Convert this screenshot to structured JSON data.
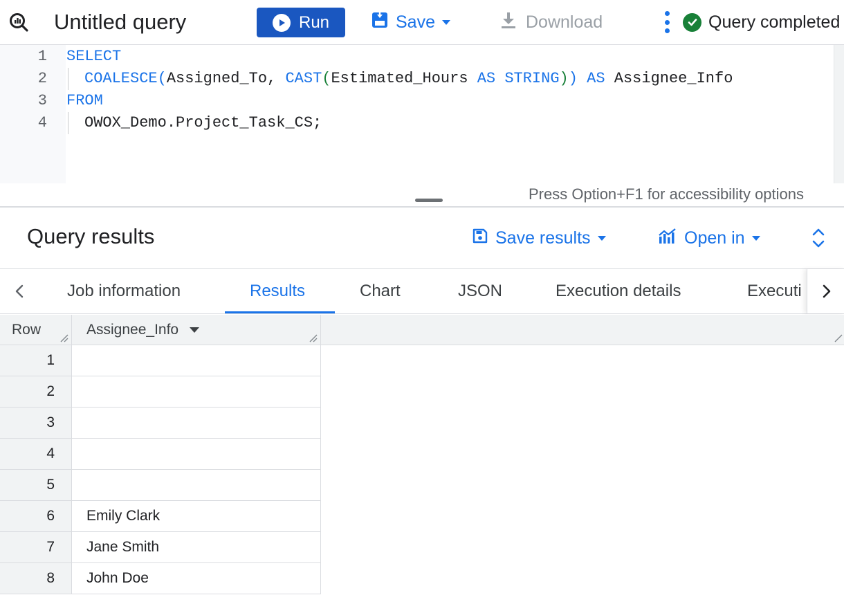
{
  "toolbar": {
    "title": "Untitled query",
    "run_label": "Run",
    "save_label": "Save",
    "download_label": "Download",
    "status_text": "Query completed"
  },
  "editor": {
    "line_numbers": [
      "1",
      "2",
      "3",
      "4"
    ],
    "line1_keyword": "SELECT",
    "line2": {
      "fn1": "COALESCE",
      "open1": "(",
      "arg1": "Assigned_To, ",
      "fn2": "CAST",
      "open2": "(",
      "arg2": "Estimated_Hours ",
      "as1": "AS",
      "type": " STRING",
      "close2": ")",
      "close1": ")",
      "as2": " AS",
      "alias": " Assignee_Info"
    },
    "line3_keyword": "FROM",
    "line4_table": "OWOX_Demo.Project_Task_CS;",
    "accessibility_hint": "Press Option+F1 for accessibility options"
  },
  "results": {
    "title": "Query results",
    "save_results_label": "Save results",
    "open_in_label": "Open in"
  },
  "tabs": {
    "job_information": "Job information",
    "results": "Results",
    "chart": "Chart",
    "json": "JSON",
    "execution_details": "Execution details",
    "execution_graph": "Executi"
  },
  "grid": {
    "row_header": "Row",
    "column_header": "Assignee_Info",
    "rows": [
      {
        "n": "1",
        "v": ""
      },
      {
        "n": "2",
        "v": ""
      },
      {
        "n": "3",
        "v": ""
      },
      {
        "n": "4",
        "v": ""
      },
      {
        "n": "5",
        "v": ""
      },
      {
        "n": "6",
        "v": "Emily Clark"
      },
      {
        "n": "7",
        "v": "Jane Smith"
      },
      {
        "n": "8",
        "v": "John Doe"
      }
    ]
  },
  "colors": {
    "accent": "#1a73e8",
    "run_button": "#1a57c0",
    "success": "#188038"
  }
}
